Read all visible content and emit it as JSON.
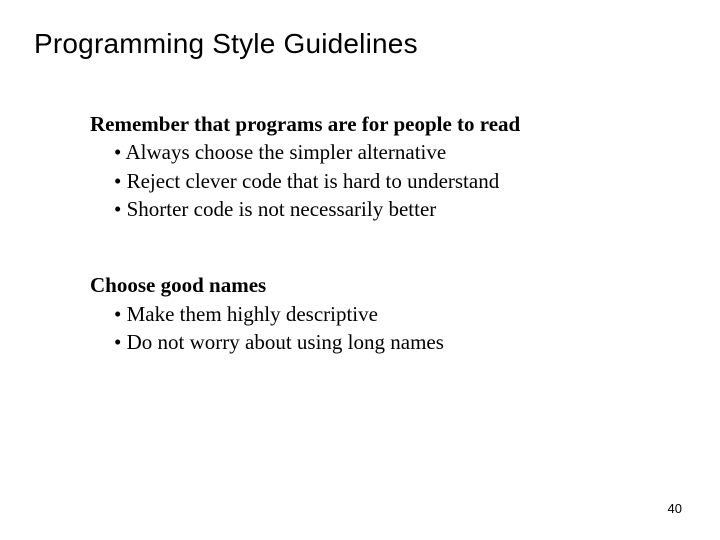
{
  "title": "Programming Style Guidelines",
  "sections": [
    {
      "heading": "Remember that programs are for people to read",
      "bullets": [
        "Always choose the simpler alternative",
        "Reject clever code that is hard to understand",
        "Shorter code is not necessarily better"
      ]
    },
    {
      "heading": "Choose good names",
      "bullets": [
        "Make them highly descriptive",
        "Do not worry about using long names"
      ]
    }
  ],
  "page_number": "40"
}
